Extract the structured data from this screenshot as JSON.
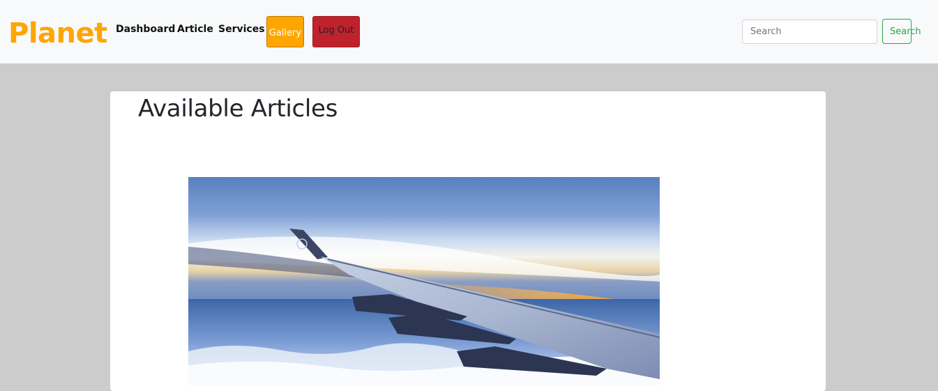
{
  "navbar": {
    "brand": "Planet",
    "links": [
      "Dashboard",
      "Article",
      "Services"
    ],
    "gallery_label": "Gallery",
    "logout_label": "Log Out",
    "search": {
      "placeholder": "Search",
      "button_label": "Search"
    }
  },
  "main": {
    "title": "Available Articles",
    "image": "airplane-wing-above-clouds-sunset-photo"
  },
  "colors": {
    "brand": "#ffa500",
    "gallery_button": "#ffa500",
    "logout_button": "#c0222d",
    "search_button": "#28a745",
    "page_background": "#cccccc",
    "navbar_background": "#f8f9fa"
  }
}
